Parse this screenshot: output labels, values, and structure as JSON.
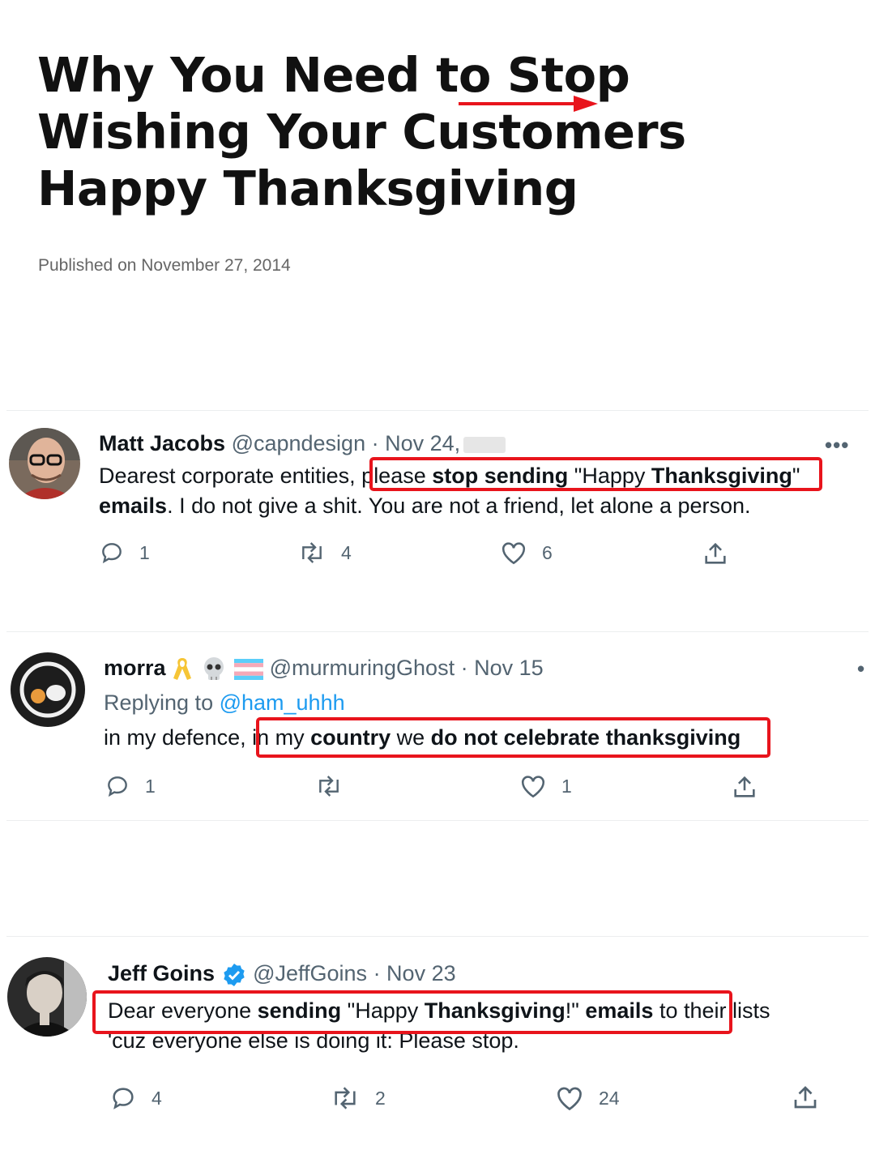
{
  "article": {
    "title": "Why You Need to Stop Wishing Your Customers Happy Thanksgiving",
    "published": "Published on November 27, 2014"
  },
  "tweets": [
    {
      "name": "Matt Jacobs",
      "handle": "@capndesign",
      "date": "· Nov 24,",
      "text": {
        "t1": "Dearest corporate entities, ",
        "t2": "please ",
        "t3": "stop sending",
        "t4": " \"Happy ",
        "t5": "Thanksgiving",
        "t6": "\"",
        "t7": "emails",
        "t8": ". I do not give a shit. You are not a friend, let alone a person."
      },
      "more": "•••",
      "replies": "1",
      "retweets": "4",
      "likes": "6"
    },
    {
      "name": "morra",
      "handle": "@murmuringGhost",
      "date": "· Nov 15",
      "replying_prefix": "Replying to ",
      "replying_to": "@ham_uhhh",
      "text": {
        "t1": "in my defence, ",
        "t2": "in my ",
        "t3": "country",
        "t4": " we ",
        "t5": "do not celebrate thanksgiving"
      },
      "more": "•",
      "replies": "1",
      "retweets": "",
      "likes": "1"
    },
    {
      "name": "Jeff Goins",
      "handle": "@JeffGoins",
      "date": "· Nov 23",
      "text": {
        "t1": "Dear everyone ",
        "t2": "sending",
        "t3": " \"Happy ",
        "t4": "Thanksgiving",
        "t5": "!\" ",
        "t6": "emails",
        "t7": " to their lists",
        "t8": "'cuz everyone else is doing it: Please stop."
      },
      "replies": "4",
      "retweets": "2",
      "likes": "24"
    }
  ],
  "icons": [
    "reply-icon",
    "retweet-icon",
    "like-icon",
    "share-icon",
    "verified-icon",
    "awareness-ribbon-icon",
    "skull-icon",
    "trans-flag-icon",
    "more-icon"
  ],
  "colors": {
    "highlight": "#e8141c",
    "link": "#1d9bf0",
    "secondary_text": "#536471",
    "verified": "#1d9bf0"
  }
}
